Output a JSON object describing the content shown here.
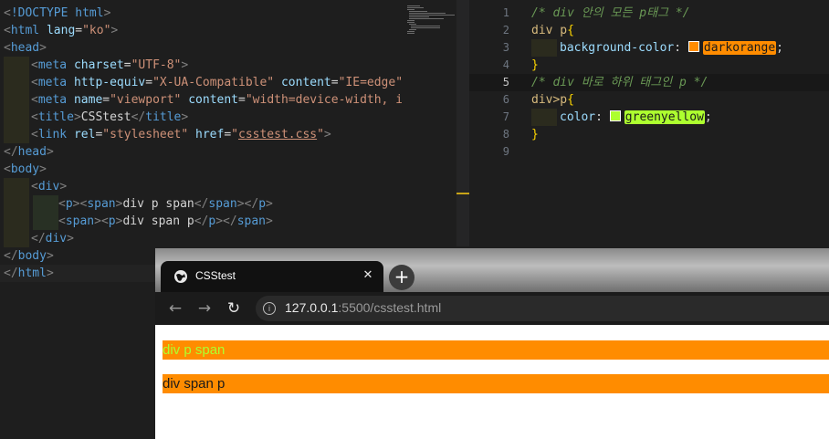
{
  "left_editor": {
    "lines": [
      {
        "parts": [
          [
            "punct",
            "<"
          ],
          [
            "tag",
            "!DOCTYPE html"
          ],
          [
            "punct",
            ">"
          ]
        ]
      },
      {
        "parts": [
          [
            "punct",
            "<"
          ],
          [
            "tag",
            "html"
          ],
          [
            "txt",
            " "
          ],
          [
            "attr",
            "lang"
          ],
          [
            "txt",
            "="
          ],
          [
            "str",
            "\"ko\""
          ],
          [
            "punct",
            ">"
          ]
        ]
      },
      {
        "parts": [
          [
            "punct",
            "<"
          ],
          [
            "tag",
            "head"
          ],
          [
            "punct",
            ">"
          ]
        ]
      },
      {
        "parts": [
          [
            "punct",
            "<"
          ],
          [
            "tag",
            "meta"
          ],
          [
            "txt",
            " "
          ],
          [
            "attr",
            "charset"
          ],
          [
            "txt",
            "="
          ],
          [
            "str",
            "\"UTF-8\""
          ],
          [
            "punct",
            ">"
          ]
        ]
      },
      {
        "parts": [
          [
            "punct",
            "<"
          ],
          [
            "tag",
            "meta"
          ],
          [
            "txt",
            " "
          ],
          [
            "attr",
            "http-equiv"
          ],
          [
            "txt",
            "="
          ],
          [
            "str",
            "\"X-UA-Compatible\""
          ],
          [
            "txt",
            " "
          ],
          [
            "attr",
            "content"
          ],
          [
            "txt",
            "="
          ],
          [
            "str",
            "\"IE=edge\""
          ]
        ]
      },
      {
        "parts": [
          [
            "punct",
            "<"
          ],
          [
            "tag",
            "meta"
          ],
          [
            "txt",
            " "
          ],
          [
            "attr",
            "name"
          ],
          [
            "txt",
            "="
          ],
          [
            "str",
            "\"viewport\""
          ],
          [
            "txt",
            " "
          ],
          [
            "attr",
            "content"
          ],
          [
            "txt",
            "="
          ],
          [
            "str",
            "\"width=device-width, in"
          ]
        ]
      },
      {
        "parts": [
          [
            "punct",
            "<"
          ],
          [
            "tag",
            "title"
          ],
          [
            "punct",
            ">"
          ],
          [
            "txt",
            "CSStest"
          ],
          [
            "punct",
            "</"
          ],
          [
            "tag",
            "title"
          ],
          [
            "punct",
            ">"
          ]
        ]
      },
      {
        "parts": [
          [
            "punct",
            "<"
          ],
          [
            "tag",
            "link"
          ],
          [
            "txt",
            " "
          ],
          [
            "attr",
            "rel"
          ],
          [
            "txt",
            "="
          ],
          [
            "str",
            "\"stylesheet\""
          ],
          [
            "txt",
            " "
          ],
          [
            "attr",
            "href"
          ],
          [
            "txt",
            "="
          ],
          [
            "str",
            "\""
          ],
          [
            "strlink",
            "csstest.css"
          ],
          [
            "str",
            "\""
          ],
          [
            "punct",
            ">"
          ]
        ]
      },
      {
        "parts": [
          [
            "punct",
            "</"
          ],
          [
            "tag",
            "head"
          ],
          [
            "punct",
            ">"
          ]
        ]
      },
      {
        "parts": [
          [
            "punct",
            "<"
          ],
          [
            "tag",
            "body"
          ],
          [
            "punct",
            ">"
          ]
        ]
      },
      {
        "parts": [
          [
            "punct",
            "<"
          ],
          [
            "tag",
            "div"
          ],
          [
            "punct",
            ">"
          ]
        ]
      },
      {
        "parts": [
          [
            "punct",
            "<"
          ],
          [
            "tag",
            "p"
          ],
          [
            "punct",
            "><"
          ],
          [
            "tag",
            "span"
          ],
          [
            "punct",
            ">"
          ],
          [
            "txt",
            "div p span"
          ],
          [
            "punct",
            "</"
          ],
          [
            "tag",
            "span"
          ],
          [
            "punct",
            "></"
          ],
          [
            "tag",
            "p"
          ],
          [
            "punct",
            ">"
          ]
        ]
      },
      {
        "parts": [
          [
            "punct",
            "<"
          ],
          [
            "tag",
            "span"
          ],
          [
            "punct",
            "><"
          ],
          [
            "tag",
            "p"
          ],
          [
            "punct",
            ">"
          ],
          [
            "txt",
            "div span p"
          ],
          [
            "punct",
            "</"
          ],
          [
            "tag",
            "p"
          ],
          [
            "punct",
            "></"
          ],
          [
            "tag",
            "span"
          ],
          [
            "punct",
            ">"
          ]
        ]
      },
      {
        "parts": [
          [
            "punct",
            "</"
          ],
          [
            "tag",
            "div"
          ],
          [
            "punct",
            ">"
          ]
        ]
      },
      {
        "parts": [
          [
            "punct",
            "</"
          ],
          [
            "tag",
            "body"
          ],
          [
            "punct",
            ">"
          ]
        ]
      },
      {
        "parts": [
          [
            "punct",
            "</"
          ],
          [
            "tag",
            "html"
          ],
          [
            "punct",
            ">"
          ]
        ]
      }
    ]
  },
  "right_editor": {
    "line_numbers": [
      "1",
      "2",
      "3",
      "4",
      "5",
      "6",
      "7",
      "8",
      "9"
    ],
    "line1_comment": "/* div 안의 모든 p태그 */",
    "line2_selector": "div p",
    "line2_brace": "{",
    "line3_property": "background-color",
    "line3_colon": ": ",
    "line3_value": "darkorange",
    "line3_semicolon": ";",
    "line4_brace": "}",
    "line5_comment": "/* div 바로 하위 태그인 p */",
    "line6_selector": "div>p",
    "line6_brace": "{",
    "line7_property": "color",
    "line7_colon": ": ",
    "line7_value": "greenyellow",
    "line7_semicolon": ";",
    "line8_brace": "}",
    "colors": {
      "darkorange": "#ff8c00",
      "greenyellow": "#adff2f"
    }
  },
  "browser": {
    "tab_title": "CSStest",
    "tab_close": "✕",
    "new_tab": "+",
    "back": "←",
    "forward": "→",
    "reload": "↻",
    "info": "i",
    "url_host": "127.0.0.1",
    "url_rest": ":5500/csstest.html",
    "p1_text": "div p span",
    "p2_text": "div span p"
  }
}
